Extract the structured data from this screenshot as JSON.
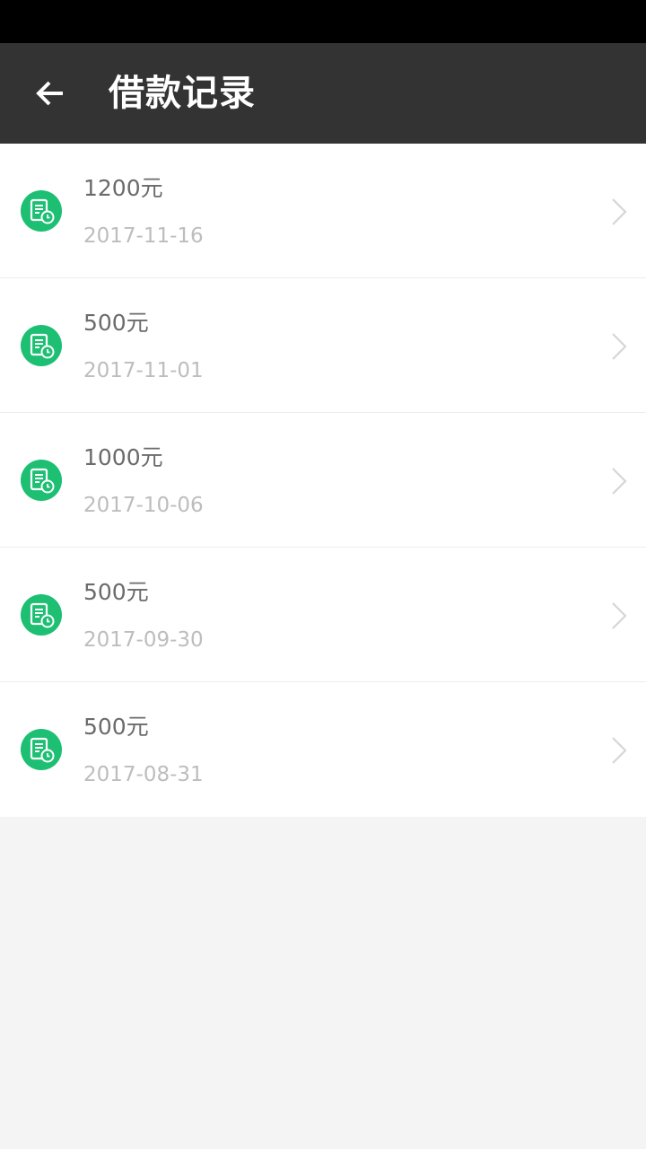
{
  "header": {
    "title": "借款记录",
    "back_icon": "arrow-left-icon"
  },
  "records": [
    {
      "amount": "1200元",
      "date": "2017-11-16"
    },
    {
      "amount": "500元",
      "date": "2017-11-01"
    },
    {
      "amount": "1000元",
      "date": "2017-10-06"
    },
    {
      "amount": "500元",
      "date": "2017-09-30"
    },
    {
      "amount": "500元",
      "date": "2017-08-31"
    }
  ],
  "colors": {
    "accent": "#1dbf73",
    "header_bg": "#333333",
    "status_bg": "#000000",
    "page_bg": "#f4f4f4"
  },
  "icons": {
    "record": "document-clock-icon",
    "chevron": "chevron-right-icon"
  }
}
